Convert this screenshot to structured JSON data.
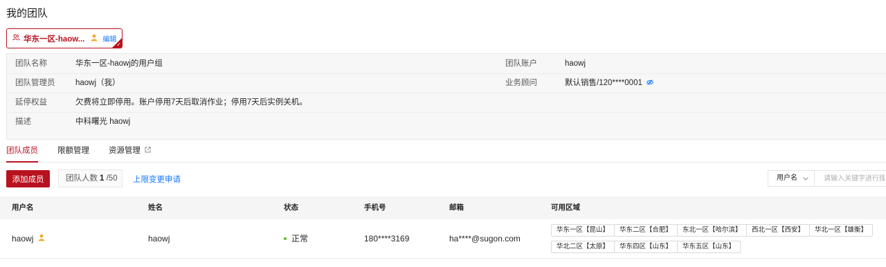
{
  "page": {
    "title": "我的团队"
  },
  "team_card": {
    "name": "华东一区-haow...",
    "edit": "编辑"
  },
  "team_info": {
    "rows": [
      {
        "label": "团队名称",
        "value": "华东一区-haowj的用户组",
        "label2": "团队账户",
        "value2": "haowj"
      },
      {
        "label": "团队管理员",
        "value": "haowj（我）",
        "label2": "业务顾问",
        "value2": "默认销售/120****0001"
      },
      {
        "label": "延停权益",
        "value": "欠费将立即停用。账户停用7天后取消作业；停用7天后实例关机。"
      },
      {
        "label": "描述",
        "value": "中科曙光 haowj"
      }
    ]
  },
  "tabs": [
    {
      "label": "团队成员",
      "active": true
    },
    {
      "label": "限额管理",
      "active": false
    },
    {
      "label": "资源管理",
      "active": false
    }
  ],
  "toolbar": {
    "add_member": "添加成员",
    "count_label": "团队人数",
    "count_value": "1",
    "count_limit": "/50",
    "limit_change": "上限变更申请",
    "search_field": "用户名",
    "search_placeholder": "请输入关键字进行搜索"
  },
  "table": {
    "columns": [
      "用户名",
      "姓名",
      "状态",
      "手机号",
      "邮箱",
      "可用区域"
    ],
    "rows": [
      {
        "username": "haowj",
        "name": "haowj",
        "status": "正常",
        "phone": "180****3169",
        "email": "ha****@sugon.com",
        "regions": [
          "华东一区【昆山】",
          "华东二区【合肥】",
          "东北一区【哈尔滨】",
          "西北一区【西安】",
          "华北一区【雄衡】",
          "华北二区【太原】",
          "华东四区【山东】",
          "华东五区【山东】"
        ]
      }
    ]
  },
  "colors": {
    "brand": "#b8121f",
    "link": "#1677ff",
    "status_ok": "#52c41a"
  }
}
